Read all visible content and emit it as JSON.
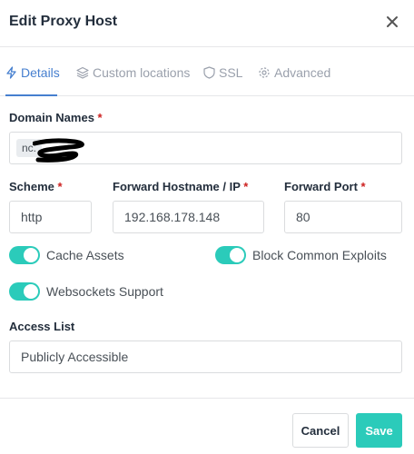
{
  "modal": {
    "title": "Edit Proxy Host",
    "close_icon": "close-icon"
  },
  "tabs": [
    {
      "label": "Details",
      "icon": "bolt-icon",
      "active": true
    },
    {
      "label": "Custom locations",
      "icon": "layers-icon",
      "active": false
    },
    {
      "label": "SSL",
      "icon": "shield-icon",
      "active": false
    },
    {
      "label": "Advanced",
      "icon": "gear-icon",
      "active": false
    }
  ],
  "form": {
    "domain_names": {
      "label": "Domain Names",
      "required": "*",
      "chip": "nc."
    },
    "scheme": {
      "label": "Scheme",
      "required": "*",
      "value": "http"
    },
    "forward_host": {
      "label": "Forward Hostname / IP",
      "required": "*",
      "value": "192.168.178.148"
    },
    "forward_port": {
      "label": "Forward Port",
      "required": "*",
      "value": "80"
    },
    "toggles": {
      "cache_assets": {
        "label": "Cache Assets",
        "on": true
      },
      "block_exploits": {
        "label": "Block Common Exploits",
        "on": true
      },
      "websockets": {
        "label": "Websockets Support",
        "on": true
      }
    },
    "access_list": {
      "label": "Access List",
      "value": "Publicly Accessible"
    }
  },
  "footer": {
    "cancel_label": "Cancel",
    "save_label": "Save"
  },
  "colors": {
    "accent": "#467fcf",
    "toggle_on": "#2bcbba",
    "save_button": "#2bcbba",
    "required": "#cd201f"
  }
}
